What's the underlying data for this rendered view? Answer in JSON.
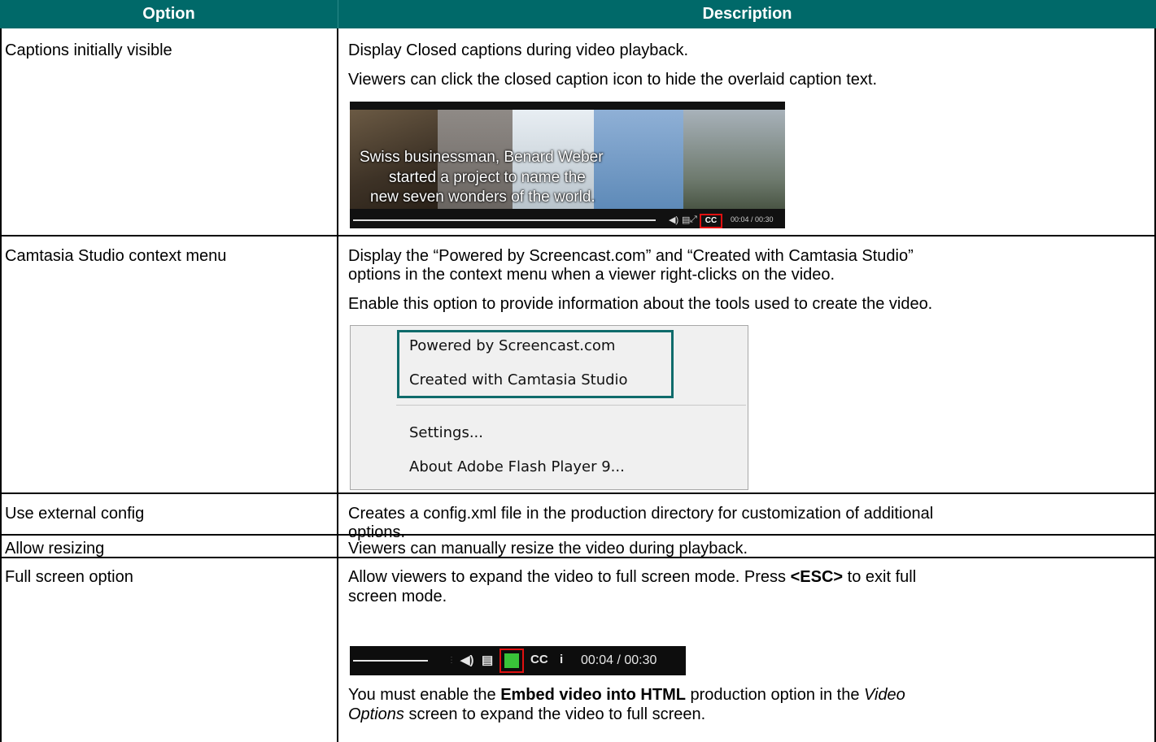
{
  "header": {
    "option": "Option",
    "description": "Description"
  },
  "rows": [
    {
      "option": "Captions initially visible",
      "desc": [
        "Display Closed captions during video playback.",
        "Viewers can click the closed caption icon to hide the overlaid caption text."
      ],
      "video": {
        "captions": [
          "Swiss businessman, Benard Weber",
          "started a project to name the",
          "new seven wonders of the world."
        ],
        "cc_label": "CC",
        "time": "00:04 / 00:30"
      }
    },
    {
      "option": "Camtasia Studio context menu",
      "desc": [
        "Display the “Powered by Screencast.com” and “Created with Camtasia Studio”",
        "options in the context menu when a viewer right-clicks on the video.",
        "Enable this option to provide information about the tools used to create the video."
      ],
      "menu": [
        "Powered by Screencast.com",
        "Created with Camtasia Studio",
        "Settings...",
        "About Adobe Flash Player 9..."
      ]
    },
    {
      "option": "Use external config",
      "desc": [
        "Creates a config.xml file in the production directory for customization of additional",
        "options."
      ]
    },
    {
      "option": "Allow resizing",
      "desc": [
        "Viewers can manually resize the video during playback."
      ]
    },
    {
      "option": "Full screen option",
      "desc_line1_pre": "Allow viewers to expand the video to full screen mode.  Press ",
      "desc_line1_bold": "<ESC>",
      "desc_line1_post": " to exit full",
      "desc_line2": "screen mode.",
      "controls": {
        "cc": "CC",
        "info": "i",
        "time": "00:04 / 00:30"
      },
      "note_pre": "You must enable the ",
      "note_bold": "Embed video into HTML",
      "note_mid": " production option in the ",
      "note_italic1": "Video",
      "note_italic2": "Options",
      "note_post": " screen to expand the video to full screen."
    }
  ]
}
